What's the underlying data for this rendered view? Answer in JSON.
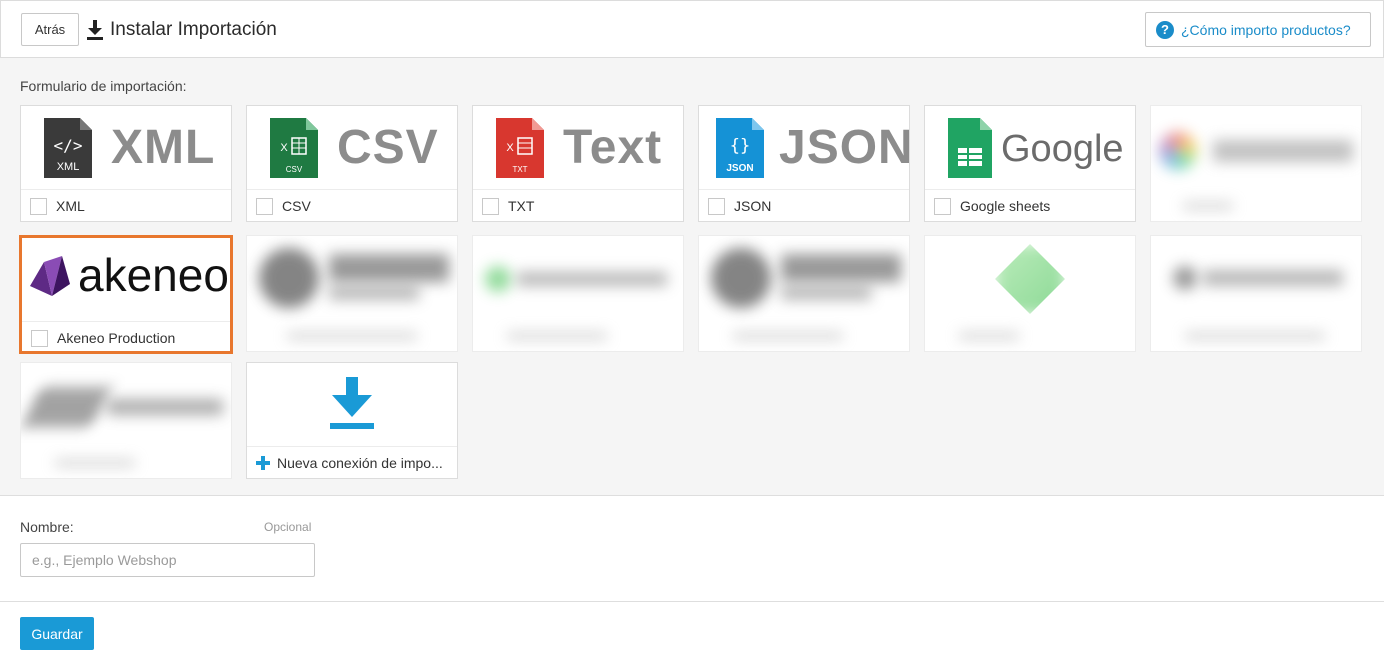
{
  "header": {
    "back_label": "Atrás",
    "title": "Instalar Importación",
    "help_label": "¿Cómo importo productos?"
  },
  "import": {
    "section_label": "Formulario de importación:",
    "formats": [
      {
        "logo_text": "XML",
        "label": "XML"
      },
      {
        "logo_text": "CSV",
        "label": "CSV"
      },
      {
        "logo_text": "Text",
        "label": "TXT"
      },
      {
        "logo_text": "JSON",
        "label": "JSON"
      },
      {
        "logo_text": "Google",
        "label": "Google sheets"
      }
    ],
    "akeneo": {
      "logo_text": "akeneo",
      "label": "Akeneo Production"
    },
    "new_connection_label": "Nueva conexión de impo..."
  },
  "form": {
    "name_label": "Nombre:",
    "optional_label": "Opcional",
    "name_placeholder": "e.g., Ejemplo Webshop"
  },
  "footer": {
    "save_label": "Guardar"
  },
  "colors": {
    "accent": "#1a9ad6",
    "selected_border": "#e8772e",
    "csv_green": "#1f7a42",
    "txt_red": "#d8372f",
    "json_blue": "#1592d6",
    "sheets_green": "#20a463",
    "akeneo_purple": "#5e2a85"
  }
}
